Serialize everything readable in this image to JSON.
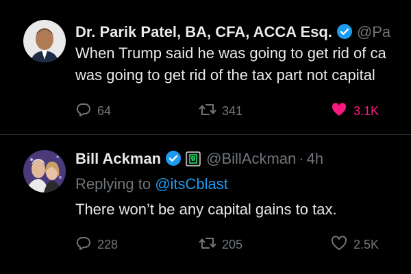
{
  "tweets": [
    {
      "name": "Dr. Parik Patel, BA, CFA, ACCA Esq.",
      "handle": "@Pa",
      "text_line1": "When Trump said he was going to get rid of ca",
      "text_line2": "was going to get rid of the tax part not capital",
      "replies": "64",
      "retweets": "341",
      "likes": "3.1K",
      "liked": true
    },
    {
      "name": "Bill Ackman",
      "handle": "@BillAckman",
      "separator": "·",
      "time": "4h",
      "replying_prefix": "Replying to",
      "replying_to": "@itsCblast",
      "text": "There won’t be any capital gains to tax.",
      "replies": "228",
      "retweets": "205",
      "likes": "2.5K",
      "liked": false
    }
  ],
  "colors": {
    "background": "#000000",
    "text": "#e7e9ea",
    "muted": "#71767b",
    "verified": "#1d9bf0",
    "like": "#f91880",
    "affiliate": "#22c55e"
  },
  "icons": [
    "verified-badge-icon",
    "affiliation-badge-icon",
    "reply-icon",
    "retweet-icon",
    "heart-icon"
  ]
}
